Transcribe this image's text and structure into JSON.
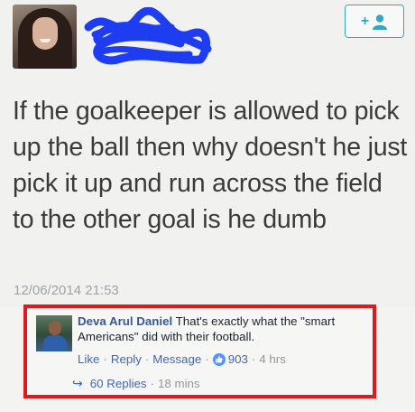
{
  "tweet": {
    "text": "If the goalkeeper is allowed to pick up the ball then why doesn't he just pick it up and run across the field to the other goal is he dumb",
    "timestamp": "12/06/2014 21:53",
    "follow_label": "+"
  },
  "comment": {
    "author": "Deva Arul Daniel",
    "text": "That's exactly what the \"smart Americans\" did with their football.",
    "actions": {
      "like": "Like",
      "reply": "Reply",
      "message": "Message",
      "like_count": "903",
      "time": "4 hrs"
    },
    "replies": {
      "label": "60 Replies",
      "time": "18 mins"
    }
  },
  "colors": {
    "accent_teal": "#39a6bd",
    "link_blue": "#4267b2",
    "highlight_red": "#e0191f",
    "scribble_blue": "#1f3df0"
  },
  "icons": [
    "add-user-icon",
    "like-thumb-icon",
    "reply-arrow-icon"
  ]
}
